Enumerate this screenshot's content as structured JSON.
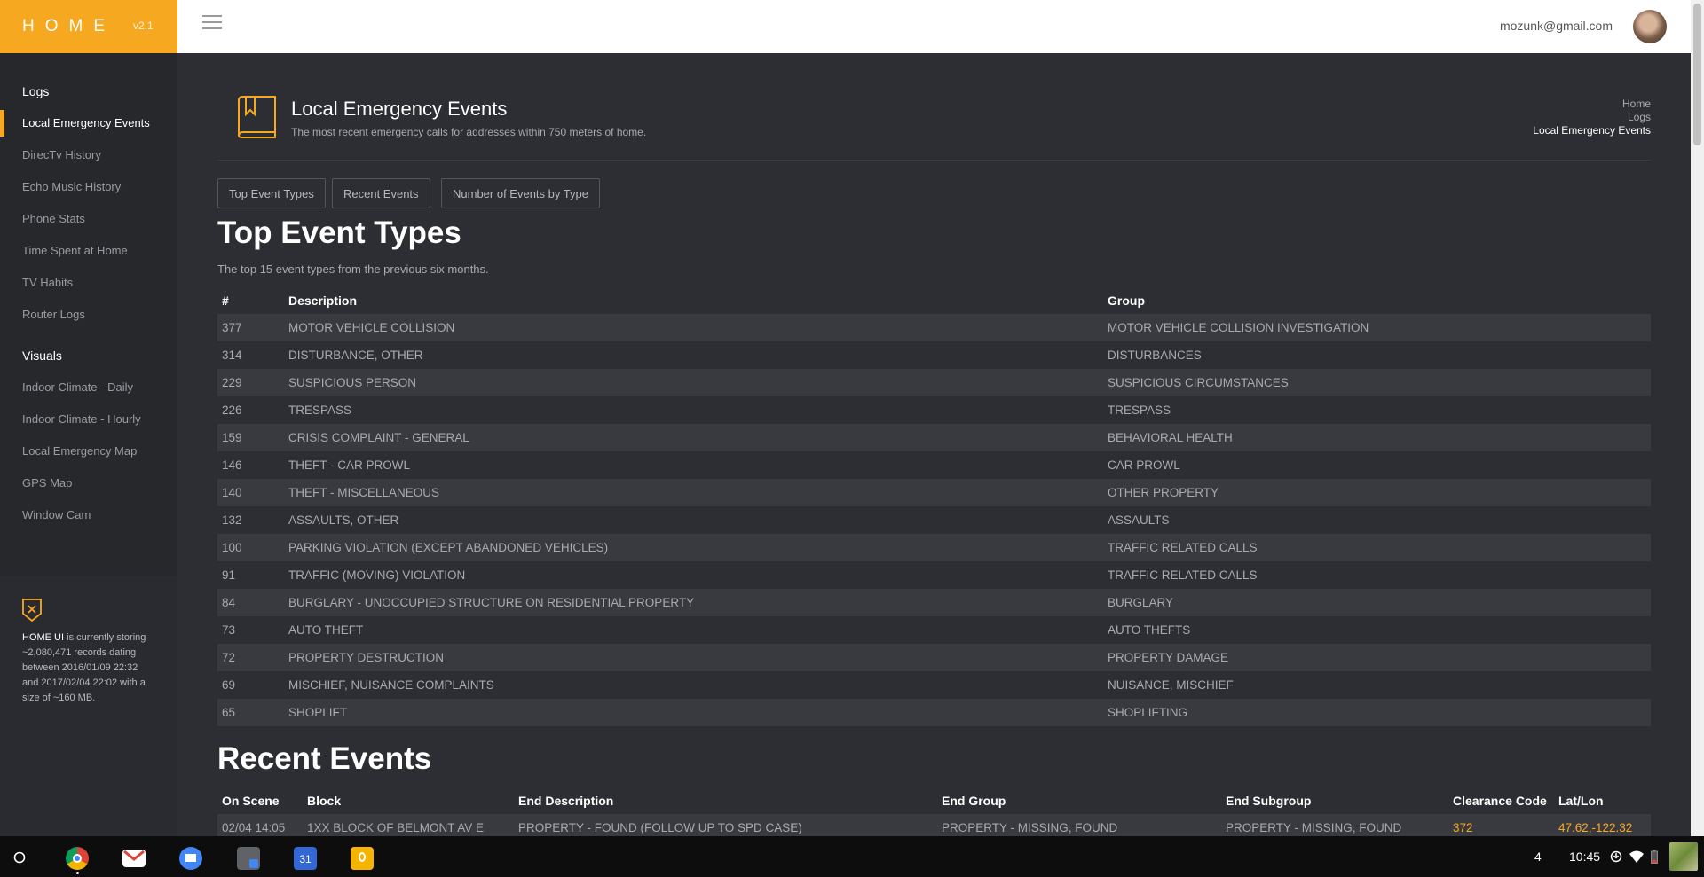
{
  "brand": {
    "name": "HOME",
    "version": "v2.1"
  },
  "user": {
    "email": "mozunk@gmail.com"
  },
  "sidebar": {
    "sections": [
      {
        "label": "Logs",
        "items": [
          "Local Emergency Events",
          "DirecTv History",
          "Echo Music History",
          "Phone Stats",
          "Time Spent at Home",
          "TV Habits",
          "Router Logs"
        ]
      },
      {
        "label": "Visuals",
        "items": [
          "Indoor Climate - Daily",
          "Indoor Climate - Hourly",
          "Local Emergency Map",
          "GPS Map",
          "Window Cam"
        ]
      }
    ],
    "active": "Local Emergency Events",
    "footer": {
      "app": "HOME UI",
      "text": " is currently storing ~2,080,471 records dating between 2016/01/09 22:32 and 2017/02/04 22:02 with a size of ~160 MB."
    }
  },
  "header": {
    "title": "Local Emergency Events",
    "subtitle": "The most recent emergency calls for addresses within 750 meters of home.",
    "breadcrumb": [
      "Home",
      "Logs",
      "Local Emergency Events"
    ]
  },
  "tabs": [
    "Top Event Types",
    "Recent Events",
    "Number of Events by Type"
  ],
  "top_events": {
    "title": "Top Event Types",
    "description": "The top 15 event types from the previous six months.",
    "columns": [
      "#",
      "Description",
      "Group"
    ],
    "rows": [
      [
        "377",
        "MOTOR VEHICLE COLLISION",
        "MOTOR VEHICLE COLLISION INVESTIGATION"
      ],
      [
        "314",
        "DISTURBANCE, OTHER",
        "DISTURBANCES"
      ],
      [
        "229",
        "SUSPICIOUS PERSON",
        "SUSPICIOUS CIRCUMSTANCES"
      ],
      [
        "226",
        "TRESPASS",
        "TRESPASS"
      ],
      [
        "159",
        "CRISIS COMPLAINT - GENERAL",
        "BEHAVIORAL HEALTH"
      ],
      [
        "146",
        "THEFT - CAR PROWL",
        "CAR PROWL"
      ],
      [
        "140",
        "THEFT - MISCELLANEOUS",
        "OTHER PROPERTY"
      ],
      [
        "132",
        "ASSAULTS, OTHER",
        "ASSAULTS"
      ],
      [
        "100",
        "PARKING VIOLATION (EXCEPT ABANDONED VEHICLES)",
        "TRAFFIC RELATED CALLS"
      ],
      [
        "91",
        "TRAFFIC (MOVING) VIOLATION",
        "TRAFFIC RELATED CALLS"
      ],
      [
        "84",
        "BURGLARY - UNOCCUPIED STRUCTURE ON RESIDENTIAL PROPERTY",
        "BURGLARY"
      ],
      [
        "73",
        "AUTO THEFT",
        "AUTO THEFTS"
      ],
      [
        "72",
        "PROPERTY DESTRUCTION",
        "PROPERTY DAMAGE"
      ],
      [
        "69",
        "MISCHIEF, NUISANCE COMPLAINTS",
        "NUISANCE, MISCHIEF"
      ],
      [
        "65",
        "SHOPLIFT",
        "SHOPLIFTING"
      ]
    ]
  },
  "recent_events": {
    "title": "Recent Events",
    "columns": [
      "On Scene",
      "Block",
      "End Description",
      "End Group",
      "End Subgroup",
      "Clearance Code",
      "Lat/Lon"
    ],
    "rows": [
      [
        "02/04 14:05",
        "1XX BLOCK OF BELMONT AV E",
        "PROPERTY - FOUND (FOLLOW UP TO SPD CASE)",
        "PROPERTY - MISSING, FOUND",
        "PROPERTY - MISSING, FOUND",
        "372",
        "47.62,-122.32"
      ]
    ]
  },
  "taskbar": {
    "notification_count": "4",
    "time": "10:45"
  },
  "colors": {
    "accent": "#f6a821",
    "background": "#2d2e33",
    "sidebar": "#27282c",
    "link": "#f6a821"
  },
  "icons": [
    "menu-icon",
    "book-icon",
    "shield-icon",
    "launcher-icon",
    "chrome-icon",
    "gmail-icon",
    "files-icon",
    "calculator-icon",
    "calendar-icon",
    "keep-icon",
    "wifi-icon",
    "battery-icon"
  ]
}
